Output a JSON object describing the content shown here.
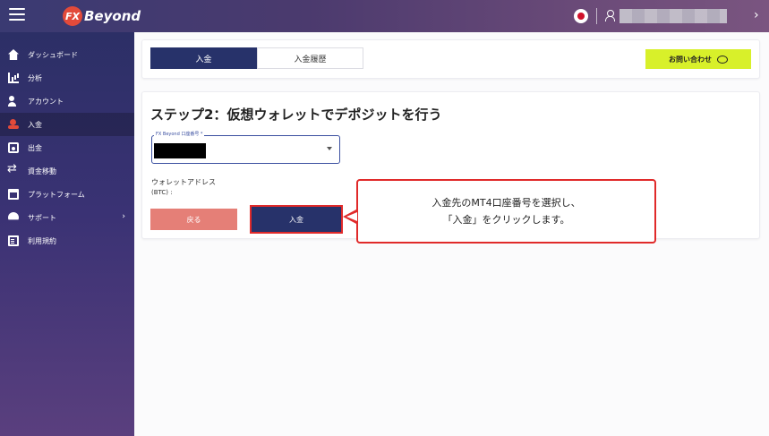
{
  "header": {
    "logo_mark": "FX",
    "logo_text": "Beyond",
    "chevron": "›"
  },
  "sidebar": {
    "items": [
      {
        "label": "ダッシュボード",
        "icon": "home-icon"
      },
      {
        "label": "分析",
        "icon": "chart-icon"
      },
      {
        "label": "アカウント",
        "icon": "account-icon"
      },
      {
        "label": "入金",
        "icon": "deposit-icon",
        "active": true
      },
      {
        "label": "出金",
        "icon": "withdraw-icon"
      },
      {
        "label": "資金移動",
        "icon": "transfer-icon"
      },
      {
        "label": "プラットフォーム",
        "icon": "platform-icon"
      },
      {
        "label": "サポート",
        "icon": "support-icon",
        "chevron": "›"
      },
      {
        "label": "利用規約",
        "icon": "terms-icon"
      }
    ]
  },
  "tabs": [
    {
      "label": "入金",
      "active": true
    },
    {
      "label": "入金履歴",
      "active": false
    }
  ],
  "contact_button": {
    "label": "お問い合わせ",
    "icon": "chat-bubble-icon"
  },
  "main": {
    "step_title": "ステップ2：仮想ウォレットでデポジットを行う",
    "account_field": {
      "label": "FX Beyond 口座番号 *",
      "value_redacted": true
    },
    "wallet_label": "ウォレットアドレス",
    "wallet_sub": "(BTC) :",
    "back_button": "戻る",
    "deposit_button": "入金"
  },
  "callout": {
    "line1": "入金先のMT4口座番号を選択し、",
    "line2": "「入金」をクリックします。"
  },
  "colors": {
    "primary": "#27326a",
    "accent_red": "#e02a2a",
    "back_button": "#e57f77",
    "contact": "#d8f02a"
  }
}
